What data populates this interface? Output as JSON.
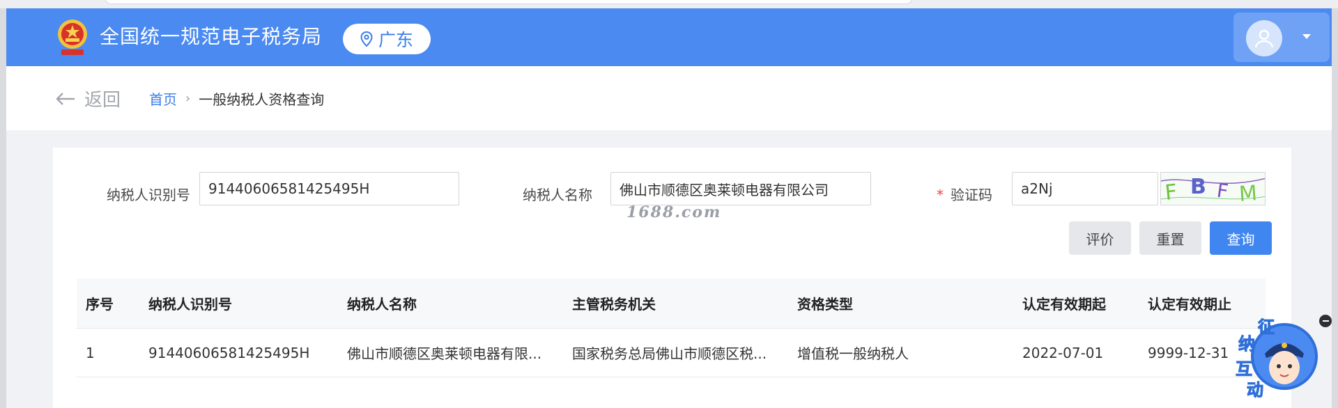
{
  "header": {
    "site_title": "全国统一规范电子税务局",
    "region": "广东",
    "logo_icon": "tax-emblem-icon",
    "colors": {
      "brand": "#4a8af1",
      "accent": "#3a7ee8"
    }
  },
  "breadcrumb": {
    "back_label": "返回",
    "home": "首页",
    "separator": "›",
    "current": "一般纳税人资格查询"
  },
  "form": {
    "taxpayer_id": {
      "label": "纳税人识别号",
      "value": "91440606581425495H"
    },
    "taxpayer_name": {
      "label": "纳税人名称",
      "value": "佛山市顺德区奥莱顿电器有限公司"
    },
    "captcha": {
      "required_mark": "*",
      "label": "验证码",
      "value": "a2Nj",
      "image_text": "FBFM"
    }
  },
  "buttons": {
    "evaluate": "评价",
    "reset": "重置",
    "query": "查询"
  },
  "table": {
    "headers": [
      "序号",
      "纳税人识别号",
      "纳税人名称",
      "主管税务机关",
      "资格类型",
      "认定有效期起",
      "认定有效期止"
    ],
    "rows": [
      [
        "1",
        "91440606581425495H",
        "佛山市顺德区奥莱顿电器有限...",
        "国家税务总局佛山市顺德区税...",
        "增值税一般纳税人",
        "2022-07-01",
        "9999-12-31"
      ]
    ]
  },
  "watermark": "1688.com",
  "float_widget": {
    "text": [
      "征",
      "纳",
      "互",
      "动"
    ],
    "icon": "tax-officer-mascot-icon"
  }
}
